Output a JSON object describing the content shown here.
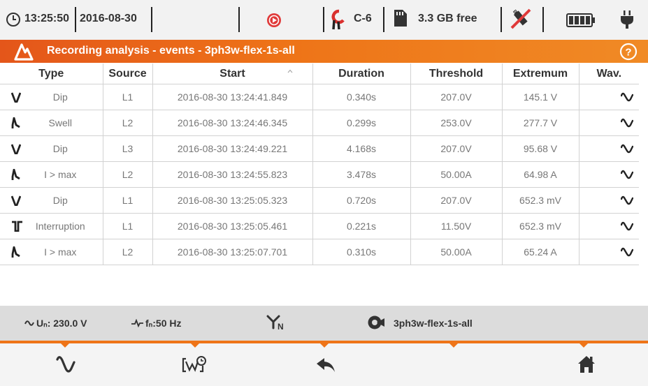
{
  "status_bar": {
    "time": "13:25:50",
    "date": "2016-08-30",
    "clamp_type": "C-6",
    "storage_free": "3.3 GB free",
    "icons": [
      "clock-icon",
      "record-icon",
      "clamp-icon",
      "sd-card-icon",
      "usb-disconnected-icon",
      "battery-icon",
      "power-plug-icon"
    ]
  },
  "title_bar": {
    "title": "Recording analysis - events - 3ph3w-flex-1s-all",
    "icons": [
      "analysis-logo-icon",
      "help-icon"
    ]
  },
  "table": {
    "headers": {
      "type": "Type",
      "source": "Source",
      "start": "Start",
      "duration": "Duration",
      "threshold": "Threshold",
      "extremum": "Extremum",
      "wav": "Wav."
    },
    "sorted_column": "Start",
    "rows": [
      {
        "icon": "dip-icon",
        "type": "Dip",
        "source": "L1",
        "start": "2016-08-30 13:24:41.849",
        "duration": "0.340s",
        "threshold": "207.0V",
        "extremum": "145.1 V"
      },
      {
        "icon": "swell-icon",
        "type": "Swell",
        "source": "L2",
        "start": "2016-08-30 13:24:46.345",
        "duration": "0.299s",
        "threshold": "253.0V",
        "extremum": "277.7 V"
      },
      {
        "icon": "dip-icon",
        "type": "Dip",
        "source": "L3",
        "start": "2016-08-30 13:24:49.221",
        "duration": "4.168s",
        "threshold": "207.0V",
        "extremum": "95.68 V"
      },
      {
        "icon": "swell-icon",
        "type": "I > max",
        "source": "L2",
        "start": "2016-08-30 13:24:55.823",
        "duration": "3.478s",
        "threshold": "50.00A",
        "extremum": "64.98 A"
      },
      {
        "icon": "dip-icon",
        "type": "Dip",
        "source": "L1",
        "start": "2016-08-30 13:25:05.323",
        "duration": "0.720s",
        "threshold": "207.0V",
        "extremum": "652.3 mV"
      },
      {
        "icon": "interruption-icon",
        "type": "Interruption",
        "source": "L1",
        "start": "2016-08-30 13:25:05.461",
        "duration": "0.221s",
        "threshold": "11.50V",
        "extremum": "652.3 mV"
      },
      {
        "icon": "swell-icon",
        "type": "I > max",
        "source": "L2",
        "start": "2016-08-30 13:25:07.701",
        "duration": "0.310s",
        "threshold": "50.00A",
        "extremum": "65.24 A"
      }
    ]
  },
  "info_bar": {
    "nominal_voltage": "Uₙ: 230.0 V",
    "nominal_frequency": "fₙ:50 Hz",
    "config_name": "3ph3w-flex-1s-all",
    "icons": [
      "sine-wave-icon",
      "frequency-icon",
      "three-phase-neutral-icon",
      "measurement-config-icon"
    ]
  },
  "bottom_bar": {
    "buttons": [
      "waveform-button",
      "events-list-button",
      "back-button",
      "empty-button",
      "home-button"
    ]
  },
  "colors": {
    "accent": "#ee7418",
    "title_gradient_start": "#e4561a",
    "record_red": "#e03a3a",
    "clamp_red": "#d9302e",
    "text_dark": "#333333",
    "text_cell": "#777777"
  }
}
